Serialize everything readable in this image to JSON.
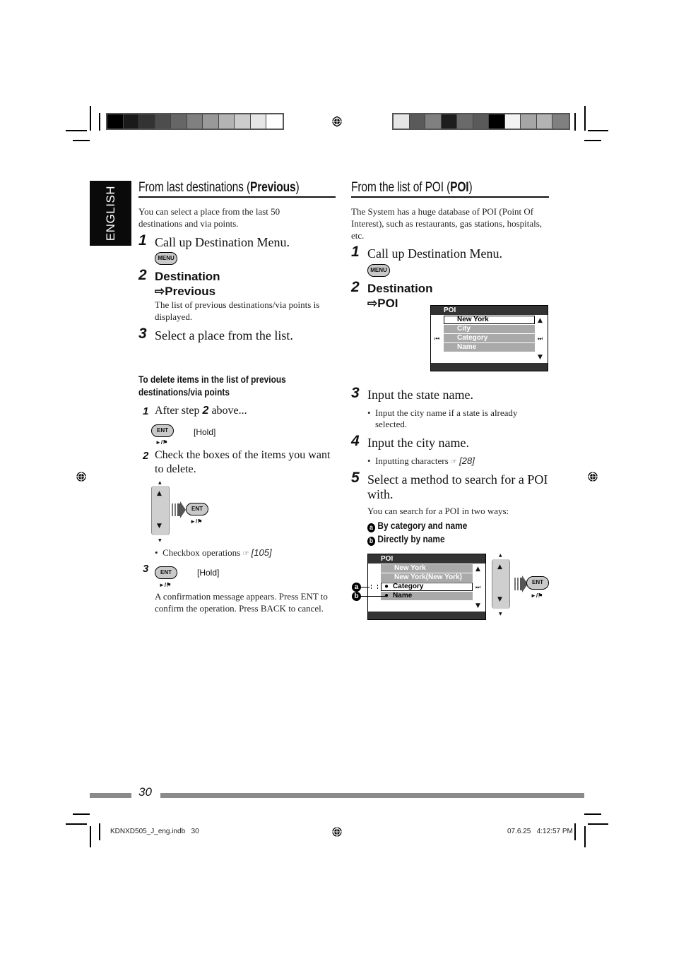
{
  "print_marks": {
    "colorbar_left": [
      "#000000",
      "#1a1a1a",
      "#333333",
      "#4d4d4d",
      "#666666",
      "#808080",
      "#999999",
      "#b3b3b3",
      "#cccccc",
      "#e6e6e6",
      "#ffffff"
    ],
    "colorbar_right": [
      "#e6e6e6",
      "#5a5a5a",
      "#808080",
      "#1e1e1e",
      "#6a6a6a",
      "#5a5a5a",
      "#000000",
      "#f2f2f2",
      "#a6a6a6",
      "#b3b3b3",
      "#808080"
    ]
  },
  "sidebar": {
    "language_tab": "ENGLISH"
  },
  "left": {
    "title_prefix": "From last destinations (",
    "title_bold": "Previous",
    "title_suffix": ")",
    "intro": "You can select a place from the last 50 destinations and via points.",
    "steps": [
      {
        "num": "1",
        "text": "Call up Destination Menu.",
        "button": "MENU"
      },
      {
        "num": "2",
        "text": "Destination",
        "text2": "⇨Previous",
        "note": "The list of previous destinations/via points is displayed."
      },
      {
        "num": "3",
        "text": "Select a place from the list."
      }
    ],
    "delete_heading_line1": "To delete items in the list of previous",
    "delete_heading_line2": "destinations/via points",
    "delete_steps": [
      {
        "num": "1",
        "text_a": "After step ",
        "text_b": "2",
        "text_c": " above...",
        "button": "ENT",
        "button_sub": "►/⚑",
        "hold": "[Hold]"
      },
      {
        "num": "2",
        "text": "Check the boxes of the items you want to delete.",
        "button": "ENT",
        "button_sub": "►/⚑"
      },
      {
        "num": "3",
        "button": "ENT",
        "button_sub": "►/⚑",
        "hold": "[Hold]",
        "note": "A confirmation message appears. Press ENT to confirm the operation. Press BACK to cancel."
      }
    ],
    "bullet_checkbox": "Checkbox operations",
    "bullet_checkbox_ref": "[105]"
  },
  "right": {
    "title_prefix": "From the list of POI (",
    "title_bold": "POI",
    "title_suffix": ")",
    "intro": "The System has a huge database of POI (Point Of Interest), such as restaurants, gas stations, hospitals, etc.",
    "steps": [
      {
        "num": "1",
        "text": "Call up Destination Menu.",
        "button": "MENU"
      },
      {
        "num": "2",
        "text": "Destination",
        "text2": "⇨POI"
      },
      {
        "num": "3",
        "text": "Input the state name.",
        "bullet": "Input the city name if a state is already selected."
      },
      {
        "num": "4",
        "text": "Input the city name.",
        "bullet": "Inputting characters",
        "bullet_ref": "[28]"
      },
      {
        "num": "5",
        "text": "Select a method to search for a POI with.",
        "note": "You can search for a POI in two ways:"
      }
    ],
    "methods": [
      {
        "marker": "a",
        "label": "By category and name"
      },
      {
        "marker": "b",
        "label": "Directly by name"
      }
    ],
    "screen1": {
      "title": "POI",
      "rows": [
        "New York",
        "City",
        "Category",
        "Name"
      ],
      "selected_index": 0
    },
    "screen2": {
      "title": "POI",
      "rows": [
        "New York",
        "New York(New York)",
        "Category",
        "Name"
      ],
      "selected_index": 2,
      "ent_button": "ENT",
      "ent_sub": "►/⚑"
    }
  },
  "footer": {
    "page_number": "30",
    "slug_file": "KDNXD505_J_eng.indb   30",
    "slug_date": "07.6.25   4:12:57 PM"
  }
}
